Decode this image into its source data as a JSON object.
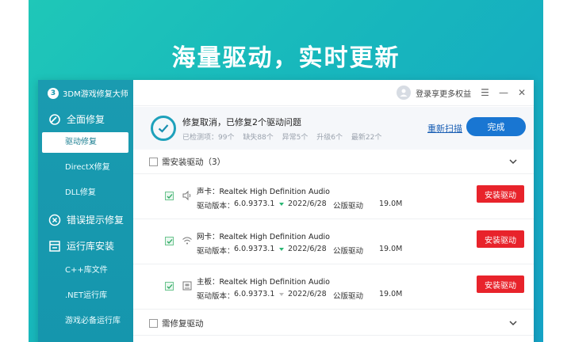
{
  "hero": {
    "title": "海量驱动，实时更新"
  },
  "app": {
    "brand": "3DM游戏修复大师"
  },
  "sidebar": {
    "groups": [
      {
        "label": "全面修复",
        "icon": "repair-icon",
        "items": [
          "驱动修复",
          "DirectX修复",
          "DLL修复"
        ]
      },
      {
        "label": "错误提示修复",
        "icon": "error-fix-icon",
        "items": []
      },
      {
        "label": "运行库安装",
        "icon": "runtime-icon",
        "items": [
          "C++库文件",
          ".NET运行库",
          "游戏必备运行库"
        ]
      }
    ],
    "active_item": "驱动修复"
  },
  "titlebar": {
    "login_text": "登录享更多权益"
  },
  "status": {
    "title": "修复取消，已修复2个驱动问题",
    "checked": "已检测项：99个",
    "missing": "缺失88个",
    "abnormal": "异常5个",
    "upgrade": "升级6个",
    "latest": "最新22个",
    "rescan_label": "重新扫描",
    "done_label": "完成"
  },
  "sections": {
    "install": "需安装驱动（3）",
    "repair": "需修复驱动"
  },
  "drivers": [
    {
      "name": "声卡：Realtek High Definition Audio",
      "icon": "speaker-icon",
      "version_label": "驱动版本：",
      "version": "6.0.9373.1",
      "date": "2022/6/28",
      "type": "公版驱动",
      "size": "19.0M",
      "arrow": "green",
      "button": "安装驱动"
    },
    {
      "name": "网卡：Realtek High Definition Audio",
      "icon": "wifi-icon",
      "version_label": "驱动版本：",
      "version": "6.0.9373.1",
      "date": "2022/6/28",
      "type": "公版驱动",
      "size": "19.0M",
      "arrow": "green",
      "button": "安装驱动"
    },
    {
      "name": "主板：Realtek High Definition Audio",
      "icon": "motherboard-icon",
      "version_label": "驱动版本：",
      "version": "6.0.9373.1",
      "date": "2022/6/28",
      "type": "公版驱动",
      "size": "19.0M",
      "arrow": "gray",
      "button": "安装驱动"
    }
  ],
  "colors": {
    "accent": "#1596ad",
    "install_button": "#e8232b",
    "done_button": "#1976d2"
  }
}
